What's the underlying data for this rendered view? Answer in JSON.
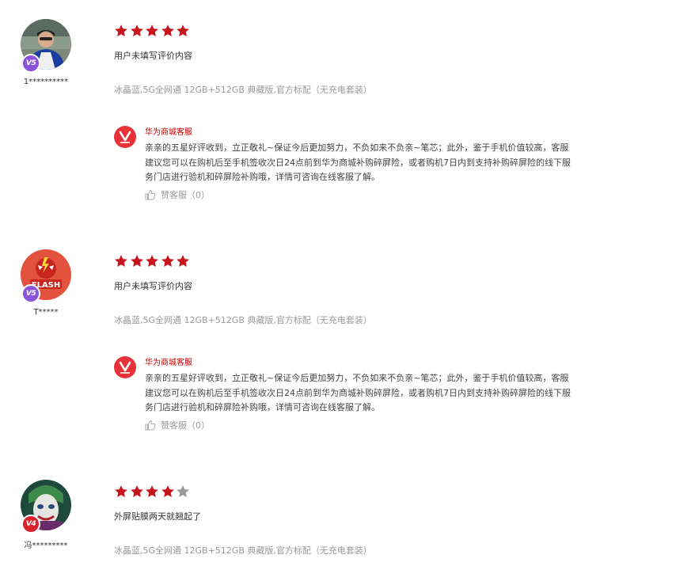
{
  "reviews": [
    {
      "username": "1**********",
      "vip": "V5",
      "avatar": "man-in-blue-jacket",
      "rating": 5,
      "content": "用户未填写评价内容",
      "spec": "冰晶蓝,5G全网通 12GB+512GB 典藏版,官方标配（无充电套装）",
      "reply": {
        "name": "华为商城客服",
        "logo": "vmall-logo",
        "text": "亲亲的五星好评收到，立正敬礼~保证今后更加努力，不负如来不负亲~笔芯；此外，鉴于手机价值较高，客服建议您可以在购机后至手机签收次日24点前到华为商城补购碎屏险，或者购机7日内到支持补购碎屏险的线下服务门店进行验机和碎屏险补购哦，详情可咨询在线客服了解。",
        "like_label": "赞客服（0）"
      }
    },
    {
      "username": "T*****",
      "vip": "V5",
      "avatar": "red-flash-cartoon",
      "rating": 5,
      "content": "用户未填写评价内容",
      "spec": "冰晶蓝,5G全网通 12GB+512GB 典藏版,官方标配（无充电套装）",
      "reply": {
        "name": "华为商城客服",
        "logo": "vmall-logo",
        "text": "亲亲的五星好评收到，立正敬礼~保证今后更加努力，不负如来不负亲~笔芯；此外，鉴于手机价值较高，客服建议您可以在购机后至手机签收次日24点前到华为商城补购碎屏险，或者购机7日内到支持补购碎屏险的线下服务门店进行验机和碎屏险补购哦，详情可咨询在线客服了解。",
        "like_label": "赞客服（0）"
      }
    },
    {
      "username": "冯*********",
      "vip": "V4",
      "avatar": "joker-portrait",
      "rating": 4,
      "content": "外屏贴膜两天就翘起了",
      "spec": "冰晶蓝,5G全网通 12GB+512GB 典藏版,官方标配（无充电套装）"
    }
  ],
  "colors": {
    "star_on": "#c8151d",
    "star_off": "#999999",
    "reply_name": "#c40000",
    "vip_v5": "#8a54d8",
    "vip_v4": "#d9242e"
  }
}
